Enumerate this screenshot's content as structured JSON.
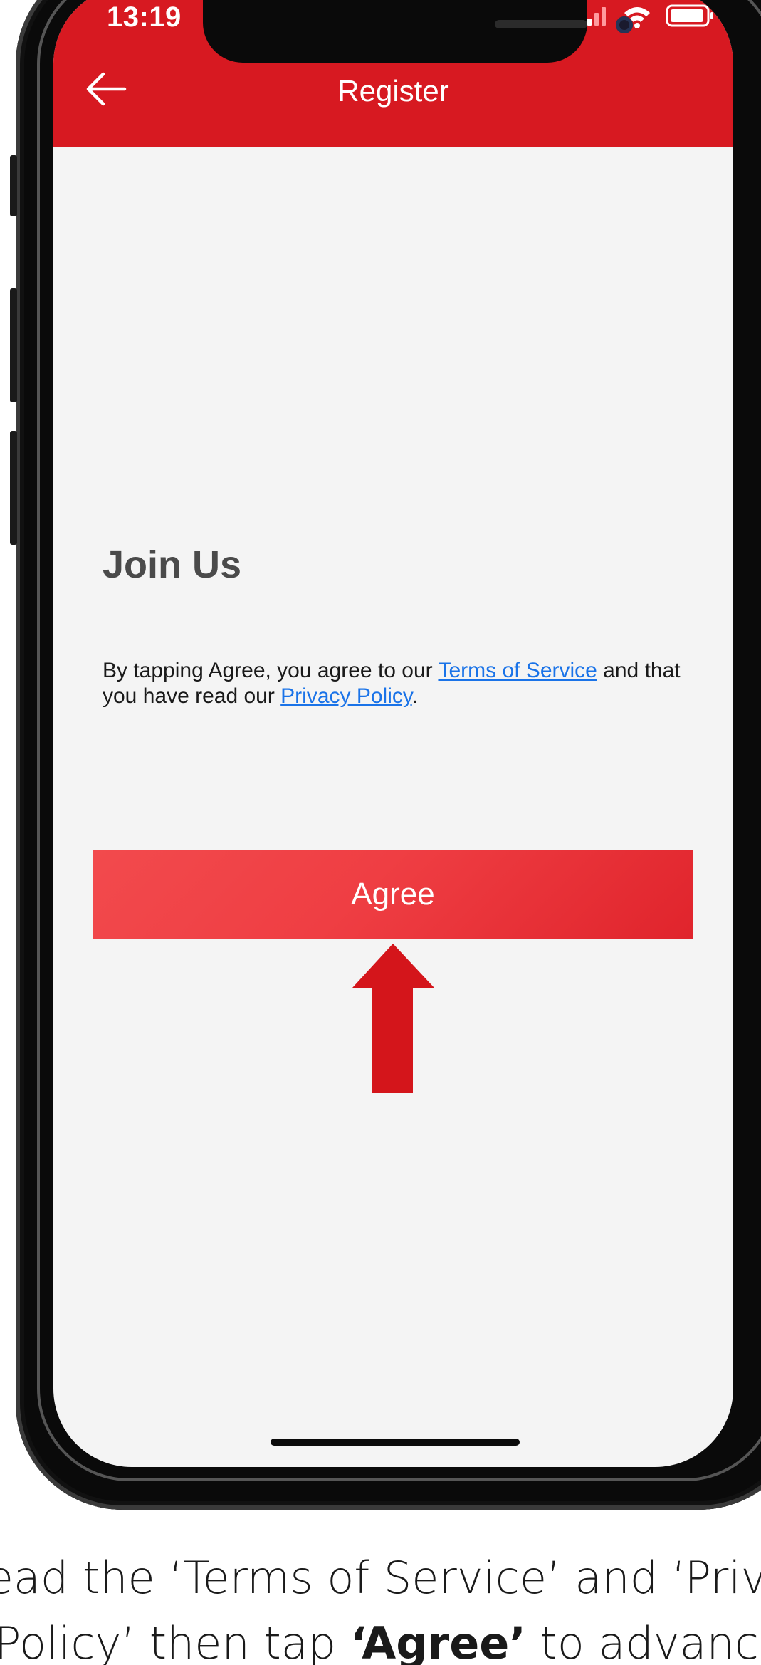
{
  "status_bar": {
    "time": "13:19",
    "icons": [
      "cellular-signal-icon",
      "wifi-icon",
      "battery-icon"
    ]
  },
  "nav": {
    "title": "Register",
    "back_icon": "arrow-left-icon"
  },
  "content": {
    "heading": "Join Us",
    "terms_prefix": "By tapping Agree, you agree to our ",
    "terms_link": "Terms of Service",
    "terms_middle": " and that you have read our ",
    "privacy_link": "Privacy Policy",
    "terms_suffix": ".",
    "agree_label": "Agree"
  },
  "caption": {
    "line1": "ead the ‘Terms of Service’ and ‘Priva",
    "line2_prefix": "Policy’ then tap ",
    "line2_bold": "‘Agree’",
    "line2_suffix": " to advance"
  },
  "colors": {
    "brand_red": "#d71921",
    "link_blue": "#1a73e8",
    "arrow_red": "#d4151b"
  }
}
